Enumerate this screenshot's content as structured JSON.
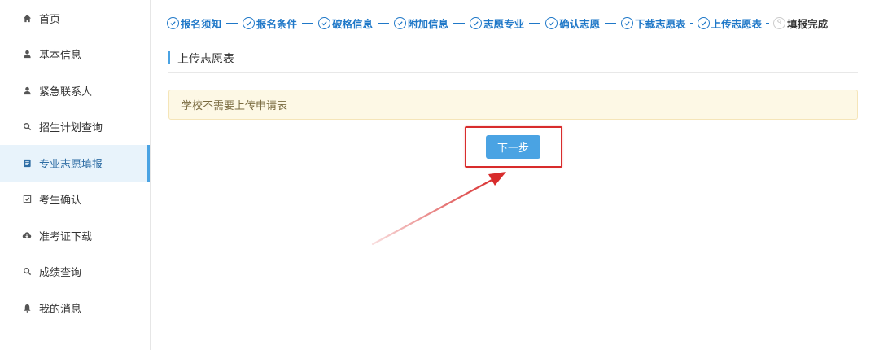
{
  "sidebar": {
    "items": [
      {
        "label": "首页",
        "icon": "home-icon",
        "active": false
      },
      {
        "label": "基本信息",
        "icon": "user-icon",
        "active": false
      },
      {
        "label": "紧急联系人",
        "icon": "user-icon",
        "active": false
      },
      {
        "label": "招生计划查询",
        "icon": "search-icon",
        "active": false
      },
      {
        "label": "专业志愿填报",
        "icon": "form-icon",
        "active": true
      },
      {
        "label": "考生确认",
        "icon": "checkbox-icon",
        "active": false
      },
      {
        "label": "准考证下载",
        "icon": "cloud-download-icon",
        "active": false
      },
      {
        "label": "成绩查询",
        "icon": "search-icon",
        "active": false
      },
      {
        "label": "我的消息",
        "icon": "bell-icon",
        "active": false
      }
    ]
  },
  "steps": [
    {
      "label": "报名须知",
      "status": "done"
    },
    {
      "label": "报名条件",
      "status": "done"
    },
    {
      "label": "破格信息",
      "status": "done"
    },
    {
      "label": "附加信息",
      "status": "done"
    },
    {
      "label": "志愿专业",
      "status": "done"
    },
    {
      "label": "确认志愿",
      "status": "done"
    },
    {
      "label": "下载志愿表",
      "status": "done"
    },
    {
      "label": "上传志愿表",
      "status": "done"
    },
    {
      "label": "填报完成",
      "status": "pending",
      "number": "9"
    }
  ],
  "main": {
    "section_title": "上传志愿表",
    "notice": "学校不需要上传申请表",
    "next_button": "下一步"
  },
  "colors": {
    "accent": "#4aa3e3",
    "step_blue": "#1f78c8",
    "highlight_red": "#d82c2c",
    "notice_bg": "#fdf8e5"
  }
}
